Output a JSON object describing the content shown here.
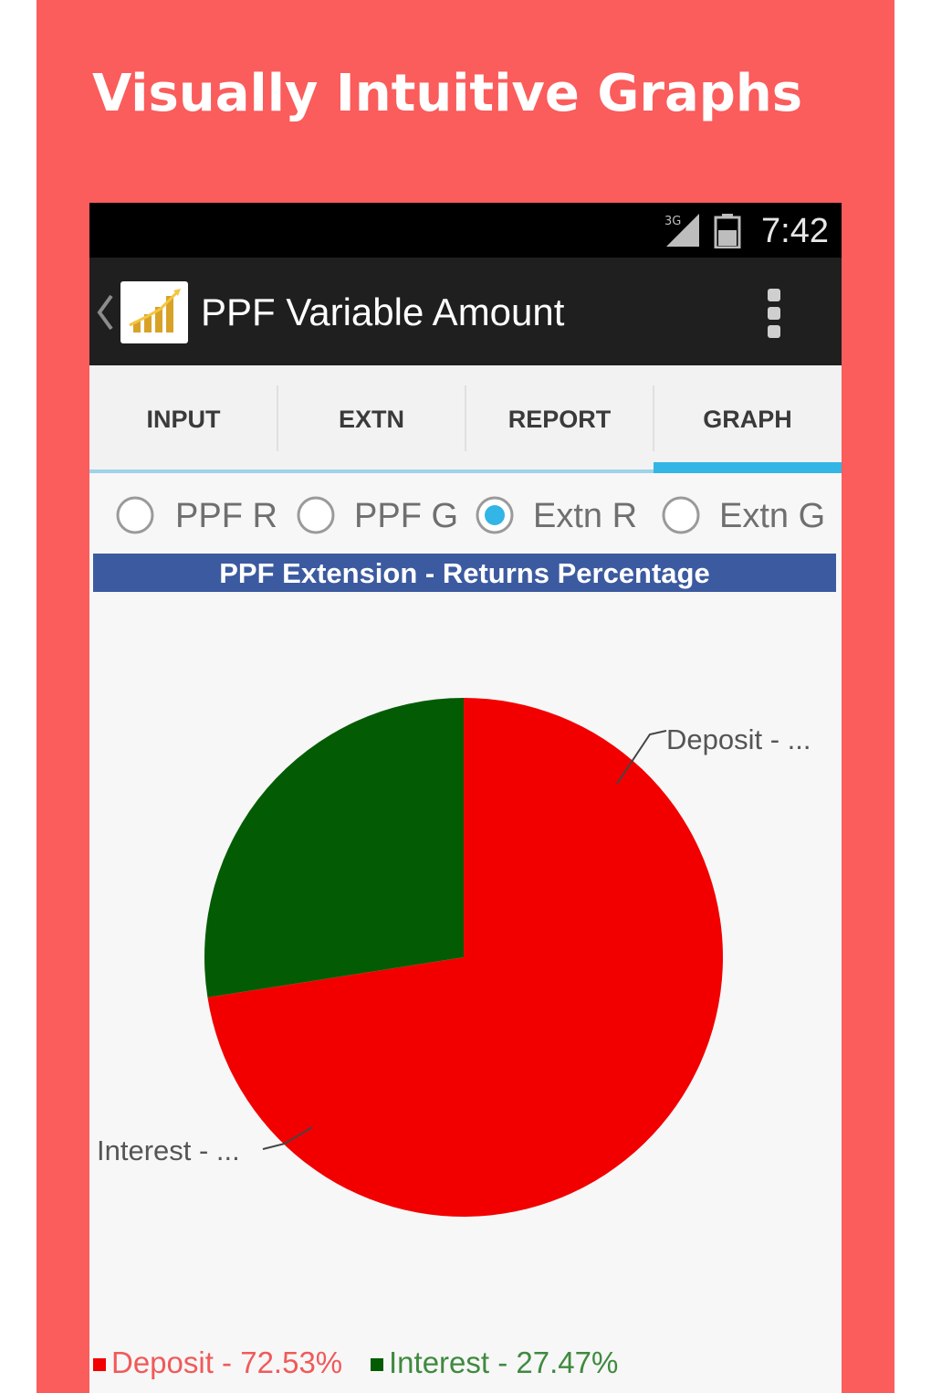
{
  "promo": {
    "title": "Visually Intuitive Graphs",
    "bg_color": "#fb5c5c"
  },
  "status_bar": {
    "time": "7:42",
    "icons": [
      "signal-icon",
      "battery-icon"
    ]
  },
  "action_bar": {
    "title": "PPF Variable Amount",
    "icons": [
      "back-chevron-icon",
      "app-logo-icon",
      "overflow-menu-icon"
    ]
  },
  "tabs": [
    {
      "label": "INPUT",
      "selected": false
    },
    {
      "label": "EXTN",
      "selected": false
    },
    {
      "label": "REPORT",
      "selected": false
    },
    {
      "label": "GRAPH",
      "selected": true
    }
  ],
  "graph_options": [
    {
      "label": "PPF R",
      "selected": false
    },
    {
      "label": "PPF G",
      "selected": false
    },
    {
      "label": "Extn R",
      "selected": true
    },
    {
      "label": "Extn G",
      "selected": false
    }
  ],
  "chart_title": "PPF Extension - Returns Percentage",
  "chart_data": {
    "type": "pie",
    "title": "PPF Extension - Returns Percentage",
    "slices": [
      {
        "label": "Deposit - ...",
        "legend": "Deposit - 72.53%",
        "value": 72.53,
        "color": "#f20000",
        "legend_text_color": "#f05a5a"
      },
      {
        "label": "Interest - ...",
        "legend": "Interest - 27.47%",
        "value": 27.47,
        "color": "#035c03",
        "legend_text_color": "#3f8a3f"
      }
    ],
    "legend_position": "bottom-left"
  }
}
